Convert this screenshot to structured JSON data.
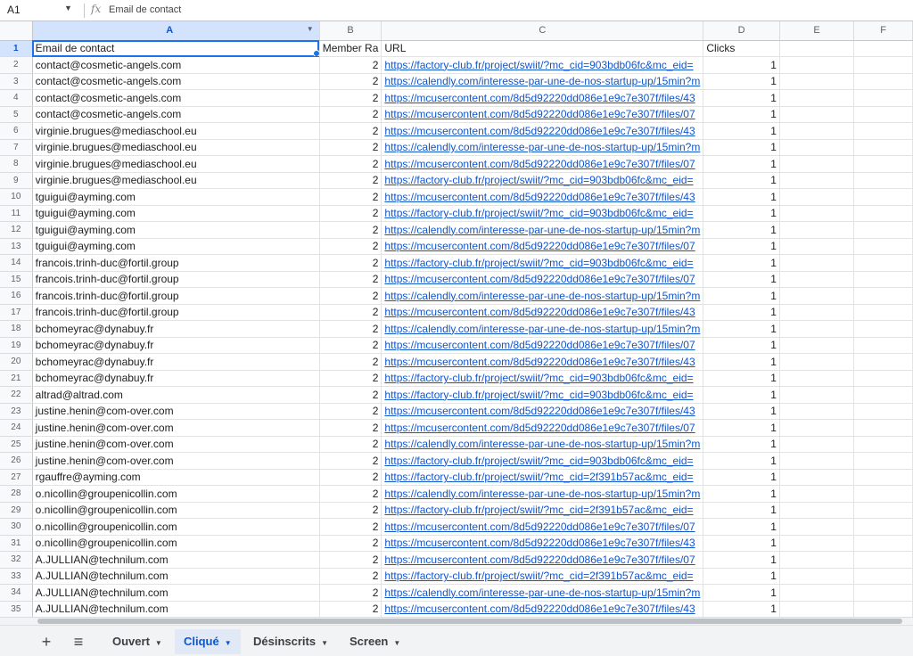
{
  "formula_bar": {
    "name_box": "A1",
    "fx": "fx",
    "content": "Email de contact"
  },
  "columns": [
    "A",
    "B",
    "C",
    "D",
    "E",
    "F"
  ],
  "header_row": {
    "a": "Email de contact",
    "b": "Member Ra",
    "c": "URL",
    "d": "Clicks"
  },
  "urls": {
    "factory1": "https://factory-club.fr/project/swiit/?mc_cid=903bdb06fc&mc_eid=",
    "factory2": "https://factory-club.fr/project/swiit/?mc_cid=2f391b57ac&mc_eid=",
    "calendly": "https://calendly.com/interesse-par-une-de-nos-startup-up/15min?m",
    "mc43": "https://mcusercontent.com/8d5d92220dd086e1e9c7e307f/files/43",
    "mc07": "https://mcusercontent.com/8d5d92220dd086e1e9c7e307f/files/07"
  },
  "rows": [
    [
      "2",
      "contact@cosmetic-angels.com",
      "2",
      "https://factory-club.fr/project/swiit/?mc_cid=903bdb06fc&mc_eid=",
      "1"
    ],
    [
      "3",
      "contact@cosmetic-angels.com",
      "2",
      "https://calendly.com/interesse-par-une-de-nos-startup-up/15min?m",
      "1"
    ],
    [
      "4",
      "contact@cosmetic-angels.com",
      "2",
      "https://mcusercontent.com/8d5d92220dd086e1e9c7e307f/files/43",
      "1"
    ],
    [
      "5",
      "contact@cosmetic-angels.com",
      "2",
      "https://mcusercontent.com/8d5d92220dd086e1e9c7e307f/files/07",
      "1"
    ],
    [
      "6",
      "virginie.brugues@mediaschool.eu",
      "2",
      "https://mcusercontent.com/8d5d92220dd086e1e9c7e307f/files/43",
      "1"
    ],
    [
      "7",
      "virginie.brugues@mediaschool.eu",
      "2",
      "https://calendly.com/interesse-par-une-de-nos-startup-up/15min?m",
      "1"
    ],
    [
      "8",
      "virginie.brugues@mediaschool.eu",
      "2",
      "https://mcusercontent.com/8d5d92220dd086e1e9c7e307f/files/07",
      "1"
    ],
    [
      "9",
      "virginie.brugues@mediaschool.eu",
      "2",
      "https://factory-club.fr/project/swiit/?mc_cid=903bdb06fc&mc_eid=",
      "1"
    ],
    [
      "10",
      "tguigui@ayming.com",
      "2",
      "https://mcusercontent.com/8d5d92220dd086e1e9c7e307f/files/43",
      "1"
    ],
    [
      "11",
      "tguigui@ayming.com",
      "2",
      "https://factory-club.fr/project/swiit/?mc_cid=903bdb06fc&mc_eid=",
      "1"
    ],
    [
      "12",
      "tguigui@ayming.com",
      "2",
      "https://calendly.com/interesse-par-une-de-nos-startup-up/15min?m",
      "1"
    ],
    [
      "13",
      "tguigui@ayming.com",
      "2",
      "https://mcusercontent.com/8d5d92220dd086e1e9c7e307f/files/07",
      "1"
    ],
    [
      "14",
      "francois.trinh-duc@fortil.group",
      "2",
      "https://factory-club.fr/project/swiit/?mc_cid=903bdb06fc&mc_eid=",
      "1"
    ],
    [
      "15",
      "francois.trinh-duc@fortil.group",
      "2",
      "https://mcusercontent.com/8d5d92220dd086e1e9c7e307f/files/07",
      "1"
    ],
    [
      "16",
      "francois.trinh-duc@fortil.group",
      "2",
      "https://calendly.com/interesse-par-une-de-nos-startup-up/15min?m",
      "1"
    ],
    [
      "17",
      "francois.trinh-duc@fortil.group",
      "2",
      "https://mcusercontent.com/8d5d92220dd086e1e9c7e307f/files/43",
      "1"
    ],
    [
      "18",
      "bchomeyrac@dynabuy.fr",
      "2",
      "https://calendly.com/interesse-par-une-de-nos-startup-up/15min?m",
      "1"
    ],
    [
      "19",
      "bchomeyrac@dynabuy.fr",
      "2",
      "https://mcusercontent.com/8d5d92220dd086e1e9c7e307f/files/07",
      "1"
    ],
    [
      "20",
      "bchomeyrac@dynabuy.fr",
      "2",
      "https://mcusercontent.com/8d5d92220dd086e1e9c7e307f/files/43",
      "1"
    ],
    [
      "21",
      "bchomeyrac@dynabuy.fr",
      "2",
      "https://factory-club.fr/project/swiit/?mc_cid=903bdb06fc&mc_eid=",
      "1"
    ],
    [
      "22",
      "altrad@altrad.com",
      "2",
      "https://factory-club.fr/project/swiit/?mc_cid=903bdb06fc&mc_eid=",
      "1"
    ],
    [
      "23",
      "justine.henin@com-over.com",
      "2",
      "https://mcusercontent.com/8d5d92220dd086e1e9c7e307f/files/43",
      "1"
    ],
    [
      "24",
      "justine.henin@com-over.com",
      "2",
      "https://mcusercontent.com/8d5d92220dd086e1e9c7e307f/files/07",
      "1"
    ],
    [
      "25",
      "justine.henin@com-over.com",
      "2",
      "https://calendly.com/interesse-par-une-de-nos-startup-up/15min?m",
      "1"
    ],
    [
      "26",
      "justine.henin@com-over.com",
      "2",
      "https://factory-club.fr/project/swiit/?mc_cid=903bdb06fc&mc_eid=",
      "1"
    ],
    [
      "27",
      "rgauffre@ayming.com",
      "2",
      "https://factory-club.fr/project/swiit/?mc_cid=2f391b57ac&mc_eid=",
      "1"
    ],
    [
      "28",
      "o.nicollin@groupenicollin.com",
      "2",
      "https://calendly.com/interesse-par-une-de-nos-startup-up/15min?m",
      "1"
    ],
    [
      "29",
      "o.nicollin@groupenicollin.com",
      "2",
      "https://factory-club.fr/project/swiit/?mc_cid=2f391b57ac&mc_eid=",
      "1"
    ],
    [
      "30",
      "o.nicollin@groupenicollin.com",
      "2",
      "https://mcusercontent.com/8d5d92220dd086e1e9c7e307f/files/07",
      "1"
    ],
    [
      "31",
      "o.nicollin@groupenicollin.com",
      "2",
      "https://mcusercontent.com/8d5d92220dd086e1e9c7e307f/files/43",
      "1"
    ],
    [
      "32",
      "A.JULLIAN@technilum.com",
      "2",
      "https://mcusercontent.com/8d5d92220dd086e1e9c7e307f/files/07",
      "1"
    ],
    [
      "33",
      "A.JULLIAN@technilum.com",
      "2",
      "https://factory-club.fr/project/swiit/?mc_cid=2f391b57ac&mc_eid=",
      "1"
    ],
    [
      "34",
      "A.JULLIAN@technilum.com",
      "2",
      "https://calendly.com/interesse-par-une-de-nos-startup-up/15min?m",
      "1"
    ],
    [
      "35",
      "A.JULLIAN@technilum.com",
      "2",
      "https://mcusercontent.com/8d5d92220dd086e1e9c7e307f/files/43",
      "1"
    ]
  ],
  "sheet_tabs": [
    {
      "label": "Ouvert",
      "active": false
    },
    {
      "label": "Cliqué",
      "active": true
    },
    {
      "label": "Désinscrits",
      "active": false
    },
    {
      "label": "Screen",
      "active": false
    }
  ],
  "icons": {
    "add_sheet": "plus-icon",
    "all_sheets": "menu-icon",
    "fx": "function-icon"
  },
  "colors": {
    "accent": "#1a73e8",
    "link": "#1155cc",
    "active_tab": "#0b57d0"
  }
}
